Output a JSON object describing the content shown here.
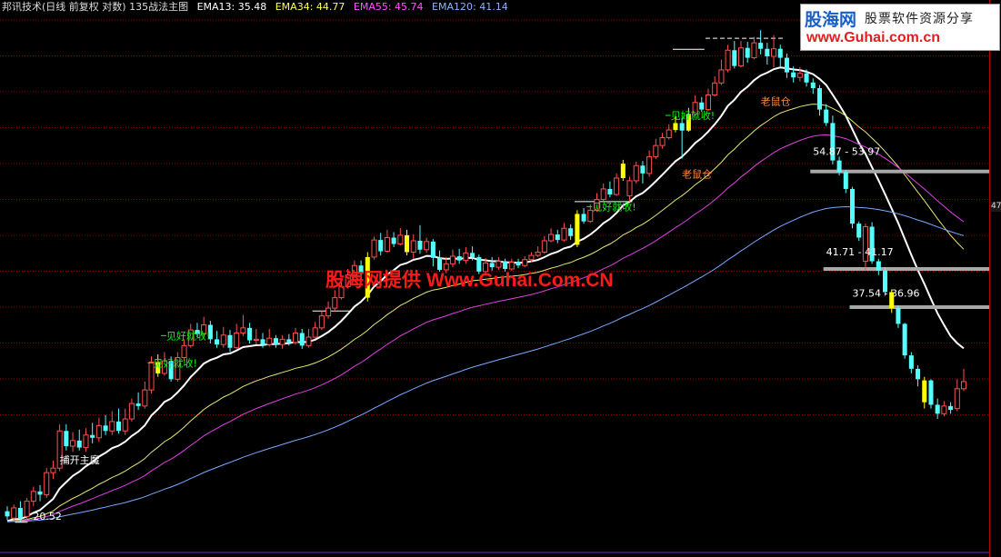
{
  "header": {
    "title": "邦讯技术(日线 前复权 对数) 135战法主图",
    "indicators": [
      {
        "label": "EMA13: 35.48",
        "color": "#ffffff"
      },
      {
        "label": "EMA34: 44.77",
        "color": "#ffff55"
      },
      {
        "label": "EMA55: 45.74",
        "color": "#ff55ff"
      },
      {
        "label": "EMA120: 41.14",
        "color": "#88b4ff"
      }
    ]
  },
  "logo": {
    "brand": "股海网",
    "slogan": "股票软件资源分享",
    "url": "www.Guhai.com.cn"
  },
  "watermark": "股海网提供 Www.Guhai.Com.CN",
  "price_axis_tag": "47",
  "colors": {
    "up": "#ff5050",
    "down": "#54ffff",
    "signal": "#ffff00",
    "ema13": "#ffffff",
    "ema34": "#e8e870",
    "ema55": "#e040e0",
    "ema120": "#7aa8ff",
    "grid": "#8a0000",
    "label_green": "#00ff00",
    "label_orange": "#ff8a3a",
    "band": "#a8a8a8"
  },
  "chart_data": {
    "type": "candlestick",
    "title": "邦讯技术(日线 前复权 对数) 135战法主图",
    "scale": "log",
    "ylim": [
      19,
      84
    ],
    "grid": true,
    "candles": [
      [
        21.0,
        20.7,
        21.3,
        20.5
      ],
      [
        20.6,
        21.2,
        21.4,
        20.5
      ],
      [
        21.2,
        20.6,
        21.6,
        20.4
      ],
      [
        20.7,
        21.6,
        21.8,
        20.5
      ],
      [
        21.6,
        22.2,
        22.5,
        21.3
      ],
      [
        22.2,
        22.0,
        22.6,
        21.6
      ],
      [
        22.0,
        23.4,
        23.7,
        21.8
      ],
      [
        23.4,
        23.7,
        24.2,
        23.0
      ],
      [
        23.7,
        26.3,
        26.8,
        23.5
      ],
      [
        26.3,
        25.2,
        26.8,
        24.9
      ],
      [
        25.2,
        25.6,
        26.2,
        24.8
      ],
      [
        25.6,
        25.1,
        26.4,
        24.9
      ],
      [
        25.1,
        26.0,
        26.5,
        24.8
      ],
      [
        26.0,
        25.8,
        26.9,
        25.4
      ],
      [
        25.8,
        26.7,
        27.3,
        25.5
      ],
      [
        26.7,
        26.3,
        27.5,
        26.0
      ],
      [
        26.3,
        27.0,
        27.8,
        26.0
      ],
      [
        27.0,
        26.3,
        28.0,
        26.1
      ],
      [
        26.3,
        27.2,
        28.0,
        26.0
      ],
      [
        27.2,
        28.4,
        28.8,
        27.0
      ],
      [
        28.4,
        28.2,
        29.3,
        27.9
      ],
      [
        28.2,
        29.5,
        30.2,
        28.0
      ],
      [
        29.5,
        31.9,
        32.4,
        29.2
      ],
      [
        31.9,
        30.9,
        32.6,
        30.6
      ],
      [
        30.9,
        32.0,
        32.8,
        30.7
      ],
      [
        32.0,
        30.4,
        32.4,
        30.2
      ],
      [
        30.4,
        32.3,
        32.8,
        30.2
      ],
      [
        32.3,
        33.4,
        34.0,
        32.0
      ],
      [
        33.4,
        34.9,
        35.5,
        33.2
      ],
      [
        34.9,
        34.5,
        35.6,
        34.2
      ],
      [
        34.5,
        35.4,
        36.2,
        34.2
      ],
      [
        35.4,
        34.0,
        35.8,
        33.6
      ],
      [
        34.0,
        33.5,
        34.8,
        33.2
      ],
      [
        33.5,
        34.4,
        35.2,
        33.2
      ],
      [
        34.4,
        33.2,
        34.9,
        32.8
      ],
      [
        33.2,
        34.6,
        35.5,
        33.1
      ],
      [
        34.6,
        35.1,
        36.4,
        34.3
      ],
      [
        35.1,
        33.9,
        35.6,
        33.6
      ],
      [
        33.9,
        34.0,
        35.0,
        33.5
      ],
      [
        34.0,
        33.5,
        34.6,
        33.2
      ],
      [
        33.5,
        34.1,
        35.0,
        33.3
      ],
      [
        34.1,
        33.5,
        34.4,
        33.2
      ],
      [
        33.5,
        34.0,
        34.4,
        33.1
      ],
      [
        34.0,
        33.7,
        34.5,
        33.4
      ],
      [
        33.7,
        34.6,
        35.1,
        33.5
      ],
      [
        34.6,
        33.4,
        35.0,
        33.1
      ],
      [
        33.4,
        34.2,
        35.0,
        33.2
      ],
      [
        34.2,
        35.1,
        35.7,
        34.0
      ],
      [
        35.1,
        36.3,
        36.8,
        34.9
      ],
      [
        36.3,
        37.1,
        37.8,
        36.0
      ],
      [
        37.1,
        38.2,
        39.0,
        36.8
      ],
      [
        38.2,
        39.4,
        40.1,
        38.0
      ],
      [
        39.4,
        40.7,
        41.4,
        39.2
      ],
      [
        40.7,
        41.8,
        42.4,
        40.4
      ],
      [
        41.8,
        40.9,
        42.4,
        40.6
      ],
      [
        38.2,
        42.8,
        43.4,
        37.8
      ],
      [
        42.8,
        44.9,
        45.3,
        42.5
      ],
      [
        44.9,
        43.5,
        45.8,
        43.0
      ],
      [
        43.5,
        45.2,
        46.2,
        43.3
      ],
      [
        45.2,
        44.4,
        45.9,
        44.0
      ],
      [
        44.4,
        45.5,
        46.4,
        44.2
      ],
      [
        45.5,
        43.4,
        46.2,
        43.0
      ],
      [
        43.4,
        44.8,
        45.6,
        42.6
      ],
      [
        44.8,
        43.7,
        46.8,
        43.2
      ],
      [
        43.7,
        44.7,
        45.2,
        43.3
      ],
      [
        44.7,
        42.7,
        45.0,
        41.7
      ],
      [
        42.7,
        41.3,
        43.6,
        41.1
      ],
      [
        41.3,
        42.0,
        42.8,
        40.9
      ],
      [
        42.0,
        42.9,
        43.7,
        41.6
      ],
      [
        42.9,
        42.4,
        43.8,
        42.0
      ],
      [
        42.4,
        43.3,
        44.0,
        42.0
      ],
      [
        43.3,
        42.8,
        44.1,
        42.4
      ],
      [
        42.8,
        41.1,
        43.1,
        40.8
      ],
      [
        41.1,
        42.1,
        42.7,
        40.9
      ],
      [
        42.1,
        41.6,
        42.8,
        41.2
      ],
      [
        41.6,
        42.3,
        42.8,
        41.3
      ],
      [
        42.3,
        41.4,
        42.6,
        41.1
      ],
      [
        41.4,
        42.2,
        42.6,
        41.2
      ],
      [
        42.2,
        41.8,
        42.6,
        41.5
      ],
      [
        41.8,
        42.5,
        42.9,
        41.6
      ],
      [
        42.5,
        43.0,
        43.4,
        42.2
      ],
      [
        43.0,
        43.4,
        44.1,
        42.8
      ],
      [
        43.4,
        44.8,
        45.4,
        43.2
      ],
      [
        44.8,
        45.6,
        46.4,
        44.6
      ],
      [
        45.6,
        44.9,
        46.2,
        44.5
      ],
      [
        44.9,
        46.4,
        47.1,
        44.7
      ],
      [
        46.4,
        45.4,
        46.9,
        44.9
      ],
      [
        44.3,
        48.3,
        48.8,
        44.0
      ],
      [
        48.3,
        47.3,
        49.1,
        47.0
      ],
      [
        47.3,
        48.8,
        49.6,
        47.1
      ],
      [
        48.8,
        50.3,
        51.2,
        48.6
      ],
      [
        50.3,
        51.8,
        52.6,
        50.0
      ],
      [
        51.8,
        51.0,
        52.9,
        50.6
      ],
      [
        51.0,
        53.4,
        54.1,
        50.8
      ],
      [
        53.4,
        55.6,
        56.2,
        53.0
      ],
      [
        50.8,
        53.0,
        53.6,
        50.0
      ],
      [
        53.0,
        55.3,
        55.9,
        52.6
      ],
      [
        55.3,
        54.1,
        56.0,
        52.6
      ],
      [
        54.1,
        56.7,
        57.7,
        53.6
      ],
      [
        56.7,
        58.5,
        59.6,
        56.3
      ],
      [
        58.5,
        59.8,
        60.6,
        58.0
      ],
      [
        59.8,
        61.1,
        62.1,
        59.5
      ],
      [
        61.1,
        62.3,
        63.6,
        60.7
      ],
      [
        62.3,
        61.0,
        63.3,
        56.4
      ],
      [
        61.0,
        63.9,
        65.0,
        60.8
      ],
      [
        63.9,
        66.0,
        67.3,
        63.5
      ],
      [
        66.0,
        64.7,
        67.0,
        64.3
      ],
      [
        64.7,
        67.4,
        68.6,
        64.4
      ],
      [
        67.4,
        69.7,
        71.0,
        67.1
      ],
      [
        69.7,
        72.3,
        74.4,
        69.3
      ],
      [
        72.3,
        76.4,
        77.6,
        71.8
      ],
      [
        76.4,
        73.1,
        78.4,
        72.6
      ],
      [
        73.1,
        76.9,
        78.4,
        72.8
      ],
      [
        76.9,
        74.8,
        78.2,
        73.8
      ],
      [
        74.8,
        78.0,
        79.3,
        74.5
      ],
      [
        78.0,
        76.7,
        80.8,
        75.5
      ],
      [
        76.7,
        75.1,
        78.0,
        73.4
      ],
      [
        75.1,
        76.7,
        79.7,
        72.8
      ],
      [
        76.7,
        74.8,
        77.6,
        73.0
      ],
      [
        74.8,
        71.8,
        75.7,
        70.7
      ],
      [
        71.8,
        70.8,
        73.0,
        69.8
      ],
      [
        70.8,
        71.6,
        72.9,
        70.0
      ],
      [
        71.6,
        69.8,
        72.4,
        69.0
      ],
      [
        69.8,
        68.7,
        70.6,
        67.6
      ],
      [
        68.7,
        64.7,
        69.3,
        63.6
      ],
      [
        64.7,
        62.3,
        65.7,
        61.8
      ],
      [
        62.3,
        56.1,
        63.6,
        55.5
      ],
      [
        56.1,
        54.3,
        56.7,
        53.8
      ],
      [
        54.3,
        51.8,
        54.6,
        51.2
      ],
      [
        51.8,
        47.0,
        52.1,
        46.4
      ],
      [
        47.0,
        45.2,
        47.3,
        44.8
      ],
      [
        42.3,
        46.6,
        47.0,
        41.2
      ],
      [
        46.6,
        42.3,
        47.2,
        42.0
      ],
      [
        42.3,
        41.2,
        42.6,
        40.7
      ],
      [
        41.2,
        38.8,
        41.6,
        38.4
      ],
      [
        38.8,
        37.1,
        39.1,
        36.6
      ],
      [
        37.1,
        35.5,
        37.4,
        35.1
      ],
      [
        35.5,
        32.5,
        35.6,
        32.2
      ],
      [
        32.5,
        31.3,
        32.8,
        30.9
      ],
      [
        31.3,
        30.4,
        31.6,
        29.8
      ],
      [
        28.5,
        30.3,
        30.6,
        28.0
      ],
      [
        30.3,
        28.3,
        30.4,
        28.0
      ],
      [
        28.3,
        27.6,
        28.8,
        27.2
      ],
      [
        27.6,
        28.2,
        28.6,
        27.4
      ],
      [
        28.2,
        27.9,
        28.5,
        27.6
      ],
      [
        28.0,
        29.6,
        30.4,
        27.8
      ],
      [
        29.6,
        30.2,
        31.3,
        29.4
      ]
    ],
    "signal_bars": [
      23,
      55,
      61,
      87,
      94,
      102,
      104,
      135,
      140
    ],
    "ema": [
      {
        "name": "EMA13",
        "value": 35.48,
        "period": 13
      },
      {
        "name": "EMA34",
        "value": 44.77,
        "period": 34
      },
      {
        "name": "EMA55",
        "value": 45.74,
        "period": 55
      },
      {
        "name": "EMA120",
        "value": 41.14,
        "period": 120
      }
    ],
    "annotations": [
      {
        "text": "20.52",
        "bar": 2,
        "price": 20.52,
        "kind": "low"
      },
      {
        "text": "捕开主魔",
        "bar": 8,
        "price": 24.0,
        "kind": "white"
      },
      {
        "text": "见好就收!",
        "bar": 22,
        "price": 31.5,
        "kind": "green"
      },
      {
        "text": "见好就收!",
        "bar": 24,
        "price": 34.0,
        "kind": "green"
      },
      {
        "text": "见好就收!",
        "bar": 89,
        "price": 48.8,
        "kind": "green"
      },
      {
        "text": "见好就收!",
        "bar": 101,
        "price": 63.0,
        "kind": "green"
      },
      {
        "text": "老鼠仓",
        "bar": 103,
        "price": 53.5,
        "kind": "orange"
      },
      {
        "text": "老鼠仓",
        "bar": 115,
        "price": 65.5,
        "kind": "orange"
      },
      {
        "text": "54.87 - 53.97",
        "bar": 123,
        "price": 57.0,
        "kind": "range"
      },
      {
        "text": "41.71 - 41.17",
        "bar": 125,
        "price": 43.0,
        "kind": "range"
      },
      {
        "text": "37.54 - 36.96",
        "bar": 129,
        "price": 38.3,
        "kind": "range"
      }
    ],
    "bands": [
      {
        "bar_from": 123,
        "price": 54.4
      },
      {
        "bar_from": 125,
        "price": 41.4
      },
      {
        "bar_from": 129,
        "price": 37.2
      }
    ],
    "support_lines": [
      {
        "bar_from": 47,
        "bar_to": 52,
        "price": 36.8
      },
      {
        "bar_from": 87,
        "bar_to": 95,
        "price": 50.0
      },
      {
        "bar_from": 102,
        "bar_to": 106,
        "price": 76.6
      },
      {
        "bar_from": 107,
        "bar_to": 118,
        "price": 79.0,
        "dashed": true
      }
    ]
  }
}
